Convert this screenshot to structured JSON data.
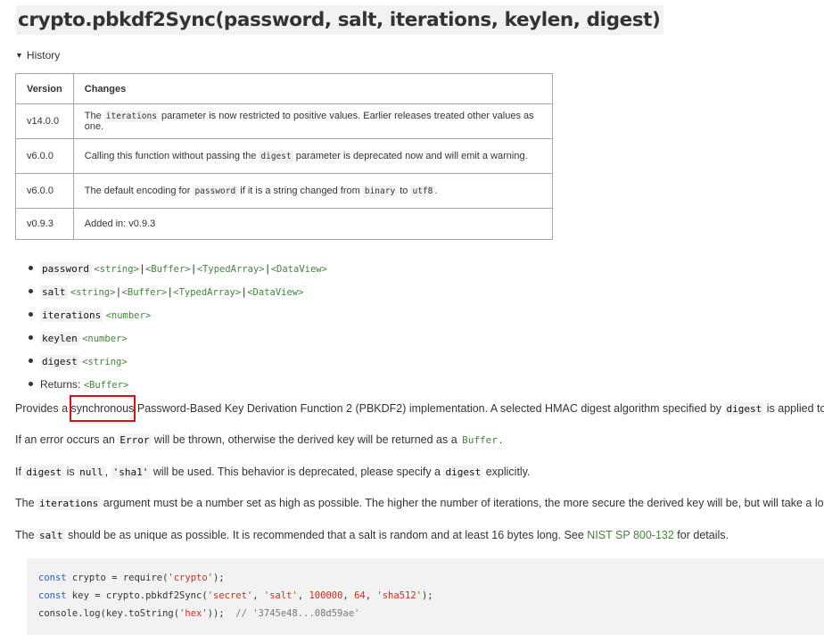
{
  "heading": "crypto.pbkdf2Sync(password, salt, iterations, keylen, digest)",
  "history": {
    "toggle_label": "History",
    "headers": {
      "version": "Version",
      "changes": "Changes"
    },
    "rows": [
      {
        "version": "v14.0.0",
        "pre": "The ",
        "code": "iterations",
        "post": " parameter is now restricted to positive values. Earlier releases treated other values as one."
      },
      {
        "version": "v6.0.0",
        "pre": "Calling this function without passing the ",
        "code": "digest",
        "post": " parameter is deprecated now and will emit a warning."
      },
      {
        "version": "v6.0.0",
        "pre": "The default encoding for ",
        "code": "password",
        "mid": " if it is a string changed from ",
        "code2": "binary",
        "mid2": " to ",
        "code3": "utf8",
        "post": "."
      },
      {
        "version": "v0.9.3",
        "text": "Added in: v0.9.3"
      }
    ]
  },
  "params": [
    {
      "name": "password",
      "types": [
        "<string>",
        "<Buffer>",
        "<TypedArray>",
        "<DataView>"
      ]
    },
    {
      "name": "salt",
      "types": [
        "<string>",
        "<Buffer>",
        "<TypedArray>",
        "<DataView>"
      ]
    },
    {
      "name": "iterations",
      "types": [
        "<number>"
      ]
    },
    {
      "name": "keylen",
      "types": [
        "<number>"
      ]
    },
    {
      "name": "digest",
      "types": [
        "<string>"
      ]
    }
  ],
  "returns": {
    "label": "Returns:",
    "type": "<Buffer>"
  },
  "type_separator": "|",
  "paragraphs": {
    "p1": {
      "a": "Provides a ",
      "highlight": "synchronous",
      "b": " Password-Based Key Derivation Function 2 (PBKDF2) implementation. A selected HMAC digest algorithm specified by ",
      "code": "digest",
      "c": " is applied to"
    },
    "p2": {
      "a": "If an error occurs an ",
      "code": "Error",
      "b": " will be thrown, otherwise the derived key will be returned as a ",
      "code2": "Buffer",
      "c": "."
    },
    "p3": {
      "a": "If ",
      "code": "digest",
      "b": " is ",
      "code2": "null",
      "c": ", ",
      "code3": "'sha1'",
      "d": " will be used. This behavior is deprecated, please specify a ",
      "code4": "digest",
      "e": " explicitly."
    },
    "p4": {
      "a": "The ",
      "code": "iterations",
      "b": " argument must be a number set as high as possible. The higher the number of iterations, the more secure the derived key will be, but will take a longe"
    },
    "p5": {
      "a": "The ",
      "code": "salt",
      "b": " should be as unique as possible. It is recommended that a salt is random and at least 16 bytes long. See ",
      "link": "NIST SP 800-132",
      "c": " for details."
    }
  },
  "code_example": {
    "line1": {
      "kw": "const",
      "a": " crypto = require(",
      "str": "'crypto'",
      "b": ");"
    },
    "line2": {
      "kw": "const",
      "a": " key = crypto.pbkdf2Sync(",
      "s1": "'secret'",
      "c1": ", ",
      "s2": "'salt'",
      "c2": ", ",
      "n1": "100000",
      "c3": ", ",
      "n2": "64",
      "c4": ", ",
      "s3": "'sha512'",
      "b": ");"
    },
    "line3": {
      "a": "console.log(key.toString(",
      "str": "'hex'",
      "b": "));  ",
      "comment": "// '3745e48...08d59ae'"
    }
  },
  "colors": {
    "type_link": "#43853d",
    "highlight_border": "#e01010",
    "code_bg": "#f2f2f2",
    "string": "#c0341d",
    "keyword": "#2c5ea8"
  }
}
